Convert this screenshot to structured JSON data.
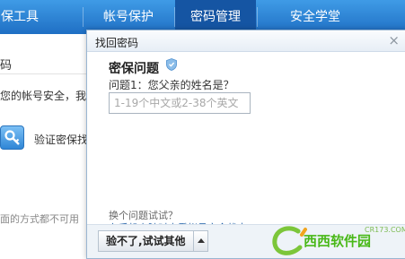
{
  "nav": {
    "items": [
      "保工具",
      "帐号保护",
      "密码管理",
      "安全学堂"
    ],
    "active_index": 2
  },
  "background": {
    "line1": "码",
    "line2": "您的帐号安全，我们",
    "verify_label": "验证密保找",
    "line4": "面的方式都不可用"
  },
  "dialog": {
    "title": "找回密码",
    "close": "×",
    "section_title": "密保问题",
    "question": "问题1：您父亲的姓名是？",
    "answer_placeholder": "1-19个中文或2-38个英文",
    "answer_value": "",
    "link_switch": "换个问题试试？",
    "link_phone": "在手机上随时查看帐号安全状态",
    "button_label": "验不了,试试其他"
  },
  "watermark": {
    "text": "西西软件园",
    "url": "CR173.COM"
  },
  "colors": {
    "nav_bg": "#2a7fd3",
    "nav_active": "#1555a3",
    "link_blue": "#1d5fa8",
    "watermark_green": "#49b818"
  }
}
